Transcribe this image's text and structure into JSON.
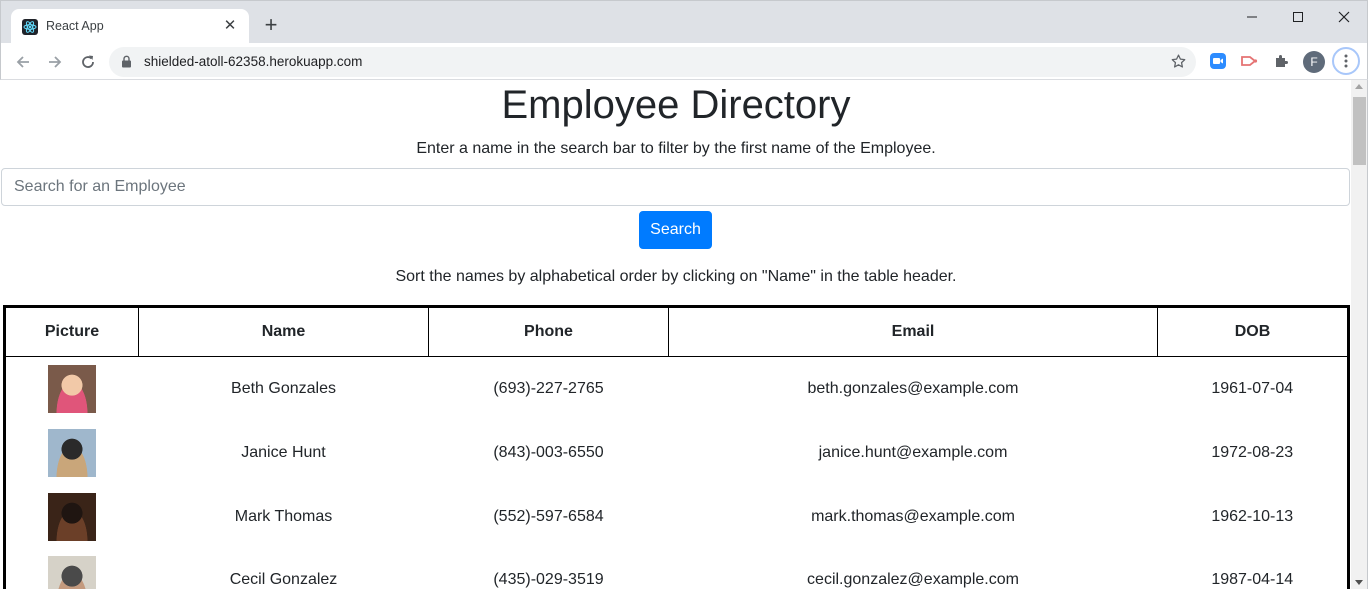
{
  "browser": {
    "tab_title": "React App",
    "tab_close": "✕",
    "new_tab": "+",
    "url": "shielded-atoll-62358.herokuapp.com",
    "profile_initial": "F"
  },
  "page": {
    "title": "Employee Directory",
    "subtitle": "Enter a name in the search bar to filter by the first name of the Employee.",
    "search_placeholder": "Search for an Employee",
    "search_button": "Search",
    "sort_note": "Sort the names by alphabetical order by clicking on \"Name\" in the table header."
  },
  "table": {
    "headers": [
      "Picture",
      "Name",
      "Phone",
      "Email",
      "DOB"
    ],
    "rows": [
      {
        "name": "Beth Gonzales",
        "phone": "(693)-227-2765",
        "email": "beth.gonzales@example.com",
        "dob": "1961-07-04",
        "avatar_colors": [
          "#7a5a4a",
          "#e0557a",
          "#f2c9a8"
        ]
      },
      {
        "name": "Janice Hunt",
        "phone": "(843)-003-6550",
        "email": "janice.hunt@example.com",
        "dob": "1972-08-23",
        "avatar_colors": [
          "#9fb7cc",
          "#c9a67a",
          "#2a2a2a"
        ]
      },
      {
        "name": "Mark Thomas",
        "phone": "(552)-597-6584",
        "email": "mark.thomas@example.com",
        "dob": "1962-10-13",
        "avatar_colors": [
          "#3a2418",
          "#6b3f28",
          "#1f1511"
        ]
      },
      {
        "name": "Cecil Gonzalez",
        "phone": "(435)-029-3519",
        "email": "cecil.gonzalez@example.com",
        "dob": "1987-04-14",
        "avatar_colors": [
          "#d6d2c8",
          "#c49a7e",
          "#4a4a4a"
        ]
      }
    ]
  }
}
